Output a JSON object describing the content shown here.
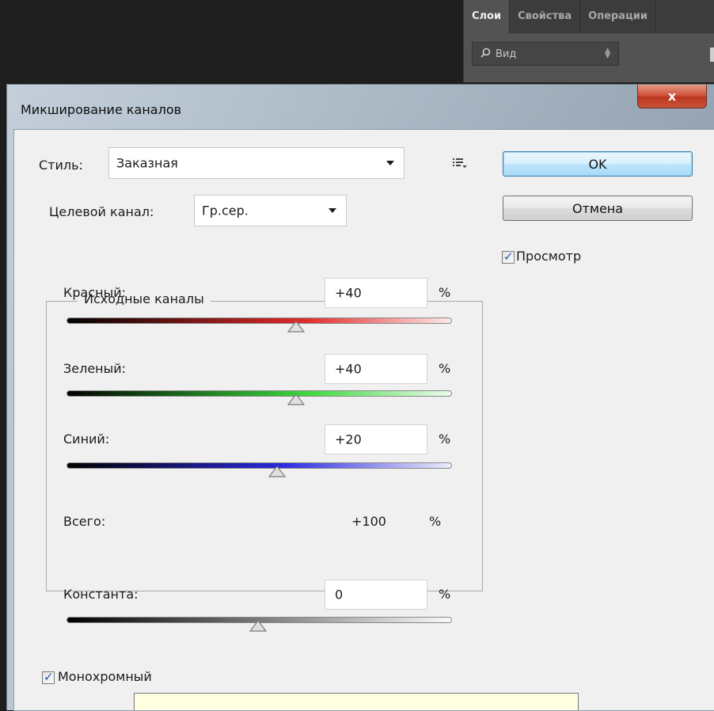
{
  "background_panel": {
    "tabs": [
      "Слои",
      "Свойства",
      "Операции"
    ],
    "filter_label": "Вид"
  },
  "dialog": {
    "title": "Микширование каналов",
    "close_glyph": "x",
    "style_label": "Стиль:",
    "style_value": "Заказная",
    "target_label": "Целевой канал:",
    "target_value": "Гр.сер.",
    "ok_label": "OK",
    "cancel_label": "Отмена",
    "preview_label": "Просмотр",
    "preview_checked": true,
    "group_title": "Исходные каналы",
    "percent_sign": "%",
    "channels": [
      {
        "label": "Красный:",
        "value": "+40",
        "color": "#e42a2a"
      },
      {
        "label": "Зеленый:",
        "value": "+40",
        "color": "#3ad83a"
      },
      {
        "label": "Синий:",
        "value": "+20",
        "color": "#2a2ae0"
      }
    ],
    "total_label": "Всего:",
    "total_value": "+100",
    "constant_label": "Константа:",
    "constant_value": "0",
    "monochrome_label": "Монохромный",
    "monochrome_checked": true,
    "checkmark": "✓"
  }
}
